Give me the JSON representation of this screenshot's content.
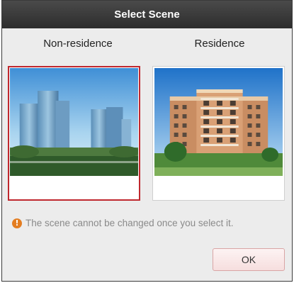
{
  "dialog": {
    "title": "Select Scene",
    "options": [
      {
        "label": "Non-residence",
        "selected": true
      },
      {
        "label": "Residence",
        "selected": false
      }
    ],
    "hint": "The scene cannot be changed once you select it.",
    "ok_label": "OK"
  },
  "colors": {
    "selected_border": "#c0282e",
    "info_icon": "#e37d21"
  }
}
